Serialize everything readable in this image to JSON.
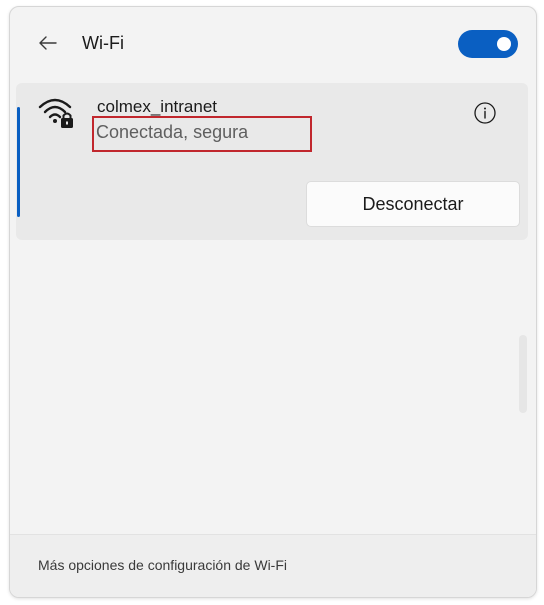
{
  "header": {
    "back_icon": "back-arrow-icon",
    "title": "Wi-Fi",
    "toggle_state": "on",
    "toggle_color": "#0a5fc2"
  },
  "network": {
    "icon": "wifi-secure-icon",
    "name": "colmex_intranet",
    "status": "Conectada, segura",
    "info_icon": "info-icon",
    "disconnect_label": "Desconectar",
    "accent_color": "#0a5fc2",
    "highlight_color": "#c1272d"
  },
  "footer": {
    "settings_link": "Más opciones de configuración de Wi-Fi"
  }
}
